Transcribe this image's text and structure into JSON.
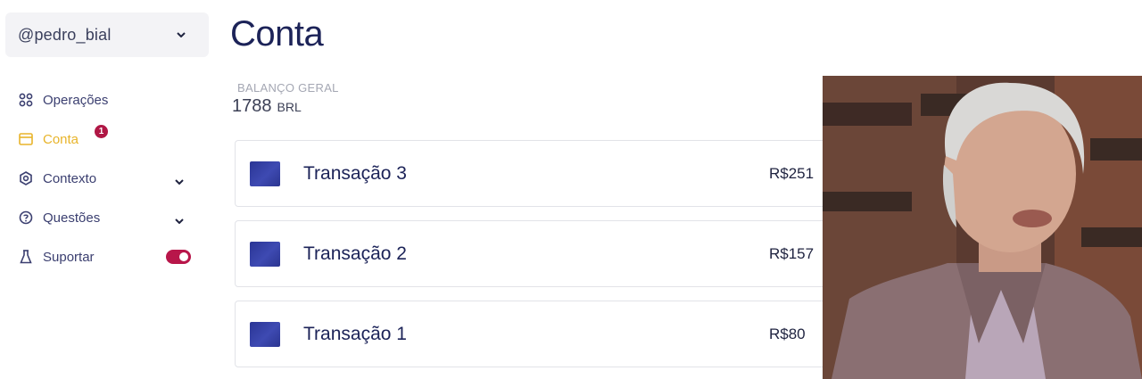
{
  "sidebar": {
    "user_handle": "@pedro_bial",
    "items": [
      {
        "label": "Operações",
        "icon": "grid-icon"
      },
      {
        "label": "Conta",
        "icon": "wallet-icon",
        "active": true,
        "badge": "1"
      },
      {
        "label": "Contexto",
        "icon": "gear-icon"
      },
      {
        "label": "Questões",
        "icon": "help-circle-icon"
      },
      {
        "label": "Suportar",
        "icon": "flask-icon",
        "toggle_on": true
      }
    ]
  },
  "main": {
    "title": "Conta",
    "balance_label": "BALANÇO GERAL",
    "balance_value": "1788",
    "balance_currency": "BRL",
    "transactions": [
      {
        "name": "Transação 3",
        "amount": "R$251"
      },
      {
        "name": "Transação 2",
        "amount": "R$157"
      },
      {
        "name": "Transação 1",
        "amount": "R$80"
      }
    ]
  },
  "colors": {
    "accent": "#e8b42a",
    "badge": "#b01745",
    "toggle": "#b8164a",
    "title": "#1c2358",
    "thumb": "#2f3a9e"
  }
}
